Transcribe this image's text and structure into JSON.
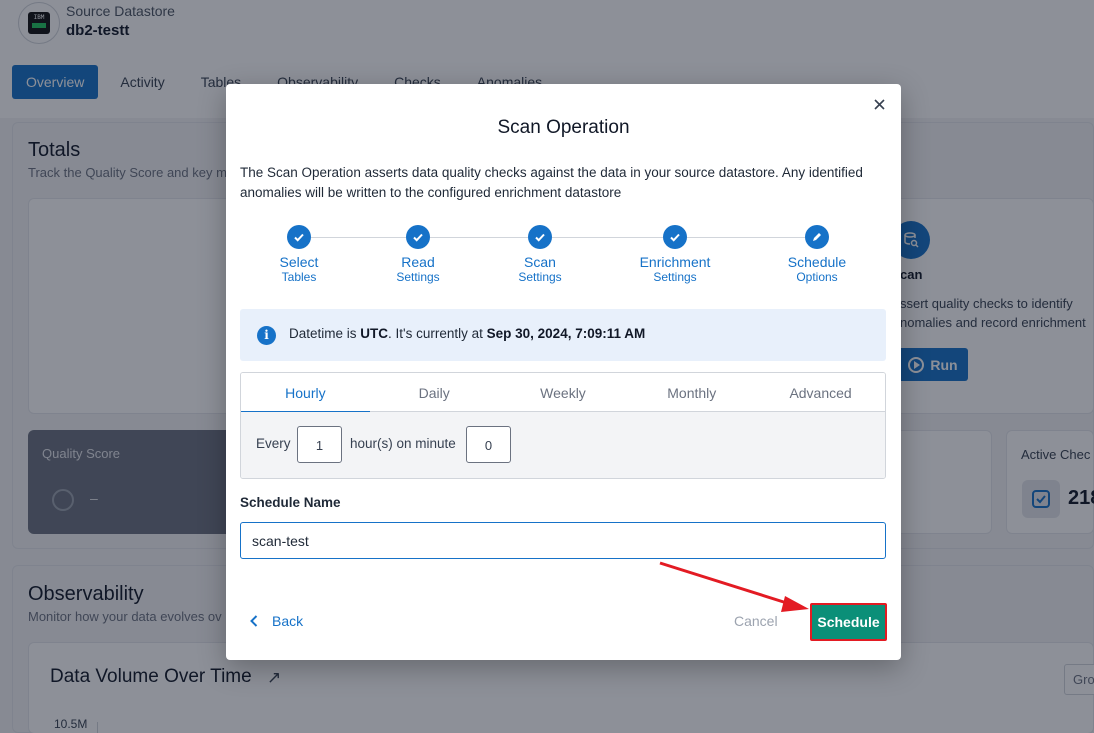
{
  "header": {
    "datastore_type": "Source Datastore",
    "datastore_name": "db2-testt",
    "logo_text": "IBM"
  },
  "tabs": [
    {
      "label": "Overview",
      "active": true
    },
    {
      "label": "Activity"
    },
    {
      "label": "Tables"
    },
    {
      "label": "Observability"
    },
    {
      "label": "Checks"
    },
    {
      "label": "Anomalies"
    }
  ],
  "totals": {
    "title": "Totals",
    "subtitle": "Track the Quality Score and key m",
    "quality_score_label": "Quality Score",
    "quality_score_value": "–",
    "scan_card": {
      "title": "can",
      "desc_line1": "ssert quality checks to identify",
      "desc_line2": "nomalies and record enrichment",
      "run_label": "Run"
    },
    "active_checks_label": "Active Chec",
    "active_checks_value": "218"
  },
  "observability": {
    "title": "Observability",
    "subtitle": "Monitor how your data evolves ov",
    "chart_title": "Data Volume Over Time",
    "y_tick": "10.5M",
    "group_btn": "Gro"
  },
  "modal": {
    "title": "Scan Operation",
    "description": "The Scan Operation asserts data quality checks against the data in your source datastore. Any identified anomalies will be written to the configured enrichment datastore",
    "steps": [
      {
        "title": "Select",
        "sub": "Tables",
        "status": "done"
      },
      {
        "title": "Read",
        "sub": "Settings",
        "status": "done"
      },
      {
        "title": "Scan",
        "sub": "Settings",
        "status": "done"
      },
      {
        "title": "Enrichment",
        "sub": "Settings",
        "status": "done"
      },
      {
        "title": "Schedule",
        "sub": "Options",
        "status": "current"
      }
    ],
    "info": {
      "prefix": "Datetime is ",
      "timezone": "UTC",
      "middle": ". It's currently at ",
      "datetime": "Sep 30, 2024, 7:09:11 AM"
    },
    "schedule_tabs": [
      {
        "label": "Hourly",
        "active": true
      },
      {
        "label": "Daily"
      },
      {
        "label": "Weekly"
      },
      {
        "label": "Monthly"
      },
      {
        "label": "Advanced"
      }
    ],
    "hourly": {
      "every_label": "Every",
      "hours_value": "1",
      "mid_label": "hour(s) on minute",
      "minute_value": "0"
    },
    "schedule_name_label": "Schedule Name",
    "schedule_name_value": "scan-test",
    "back_label": "Back",
    "cancel_label": "Cancel",
    "schedule_label": "Schedule"
  },
  "colors": {
    "primary": "#1672c8",
    "schedule_button": "#0b8f78",
    "highlight_border": "#e31b23",
    "annotation_arrow": "#e31b23"
  }
}
